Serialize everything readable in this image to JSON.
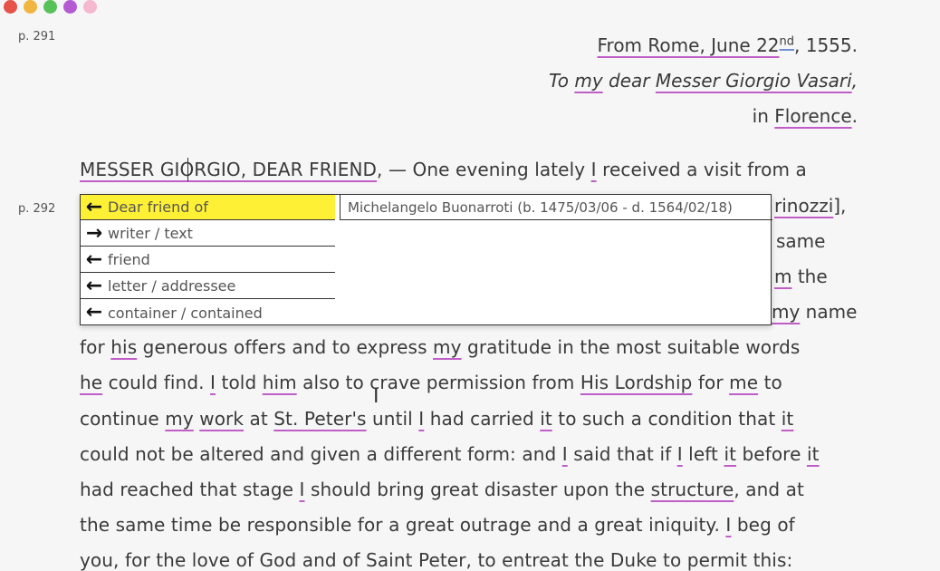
{
  "window_controls": {
    "colors": [
      "#e5534b",
      "#f2b53f",
      "#57c15a",
      "#b45bd4",
      "#f4b8cf"
    ]
  },
  "pages": {
    "p291": "p. 291",
    "p292": "p. 292"
  },
  "header": {
    "from_prefix": "From ",
    "rome": "Rome",
    "date_mid": ", June 22",
    "nd": "nd",
    "year": ", 1555.",
    "to_prefix": "To ",
    "to_my": "my",
    "dear": " dear ",
    "vasari": "Messer Giorgio Vasari",
    "vasari_comma": ",",
    "in_prefix": "in ",
    "florence": "Florence",
    "period": "."
  },
  "text": {
    "l1_a": "MESSER GIORGIO, DEAR FRIEND",
    "l1_b": ", — One evening lately ",
    "l1_i": "I",
    "l1_c": " received a visit from a",
    "l2_frag": "rinozzi",
    "l2_end": "],",
    "l3_frag": "same",
    "l4_m": "m",
    "l4_rest": " the",
    "l5_my": "my",
    "l5_rest": " name",
    "l6_a": "for ",
    "l6_his": "his",
    "l6_b": " generous offers and to express ",
    "l6_my": "my",
    "l6_c": " gratitude in the most suitable words",
    "l7_he": "he",
    "l7_a": " could find. ",
    "l7_i": "I",
    "l7_b": " told ",
    "l7_him": "him",
    "l7_c": " also to crave permission from ",
    "l7_lord": "His Lordship",
    "l7_d": " for ",
    "l7_me": "me",
    "l7_e": " to",
    "l8_a": "continue ",
    "l8_my": "my",
    "l8_sp": " ",
    "l8_work": "work",
    "l8_at": " at ",
    "l8_stp": "St. Peter's",
    "l8_b": " until ",
    "l8_i": "I",
    "l8_c": " had carried ",
    "l8_it": "it",
    "l8_d": " to such a condition that ",
    "l8_it2": "it",
    "l9_a": "could not be altered and given a different form: and ",
    "l9_i": "I",
    "l9_b": " said that if ",
    "l9_i2": "I",
    "l9_c": " left ",
    "l9_it": "it",
    "l9_d": " before ",
    "l9_it2": "it",
    "l10_a": "had reached that stage ",
    "l10_i": "I",
    "l10_b": " should bring great disaster upon the ",
    "l10_struct": "structure",
    "l10_c": ", and at",
    "l11_a": "the same time be responsible for a great outrage and a great iniquity. ",
    "l11_i": "I",
    "l11_b": " beg of",
    "l12": "you, for the love of God and of Saint Peter, to entreat the Duke to permit this:"
  },
  "popup": {
    "relations": [
      {
        "arrow": "←",
        "label": "Dear friend of"
      },
      {
        "arrow": "→",
        "label": "writer / text"
      },
      {
        "arrow": "←",
        "label": "friend"
      },
      {
        "arrow": "←",
        "label": "letter / addressee"
      },
      {
        "arrow": "←",
        "label": "container / contained"
      }
    ],
    "entity": "Michelangelo Buonarroti (b. 1475/03/06 - d. 1564/02/18)",
    "active_color": "#fef035"
  }
}
